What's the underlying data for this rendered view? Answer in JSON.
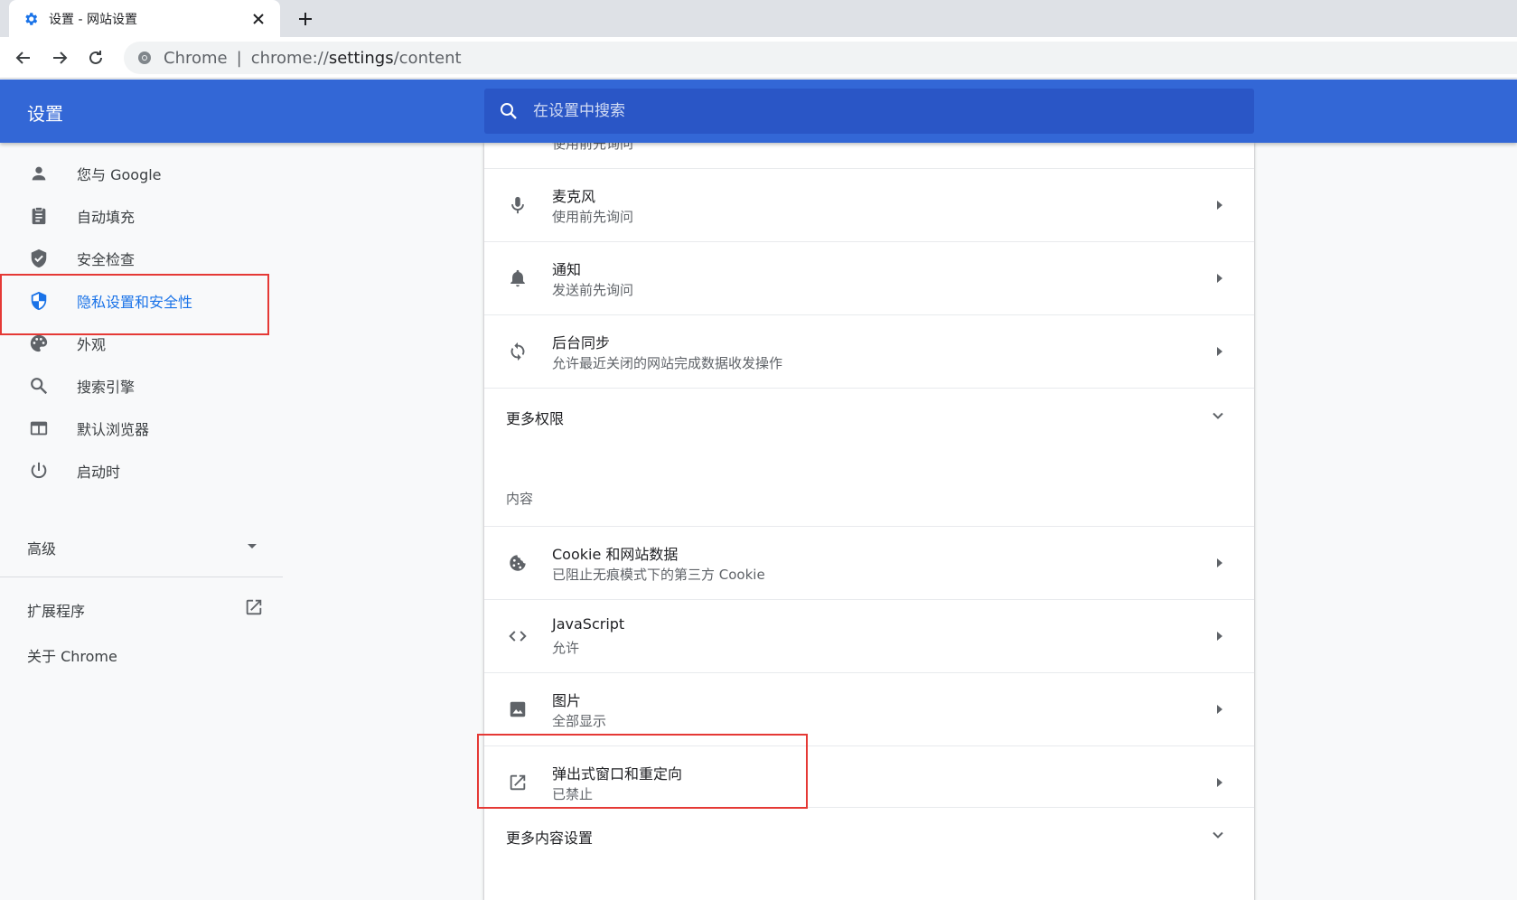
{
  "browser": {
    "tab_title": "设置 - 网站设置",
    "address": {
      "chip": "Chrome",
      "separator": "|",
      "scheme": "chrome://",
      "host": "settings",
      "path": "/content"
    }
  },
  "header": {
    "title": "设置",
    "search_placeholder": "在设置中搜索"
  },
  "sidebar": {
    "items": [
      {
        "label": "您与 Google",
        "icon": "person-icon"
      },
      {
        "label": "自动填充",
        "icon": "clipboard-icon"
      },
      {
        "label": "安全检查",
        "icon": "shield-check-icon"
      },
      {
        "label": "隐私设置和安全性",
        "icon": "shield-privacy-icon",
        "active": true
      },
      {
        "label": "外观",
        "icon": "palette-icon"
      },
      {
        "label": "搜索引擎",
        "icon": "search-icon"
      },
      {
        "label": "默认浏览器",
        "icon": "browser-window-icon"
      },
      {
        "label": "启动时",
        "icon": "power-icon"
      }
    ],
    "advanced": "高级",
    "extensions": "扩展程序",
    "about": "关于 Chrome"
  },
  "content": {
    "cut_off_text": "使用前先询问",
    "permissions": [
      {
        "title": "麦克风",
        "subtitle": "使用前先询问",
        "icon": "microphone-icon"
      },
      {
        "title": "通知",
        "subtitle": "发送前先询问",
        "icon": "bell-icon"
      },
      {
        "title": "后台同步",
        "subtitle": "允许最近关闭的网站完成数据收发操作",
        "icon": "sync-icon"
      }
    ],
    "more_permissions": "更多权限",
    "content_section_label": "内容",
    "content_items": [
      {
        "title": "Cookie 和网站数据",
        "subtitle": "已阻止无痕模式下的第三方 Cookie",
        "icon": "cookie-icon"
      },
      {
        "title": "JavaScript",
        "subtitle": "允许",
        "icon": "code-icon"
      },
      {
        "title": "图片",
        "subtitle": "全部显示",
        "icon": "image-icon"
      },
      {
        "title": "弹出式窗口和重定向",
        "subtitle": "已禁止",
        "icon": "popup-icon"
      }
    ],
    "more_content_settings": "更多内容设置"
  },
  "colors": {
    "header_blue": "#3367d6",
    "search_blue": "#2a56c6",
    "active_blue": "#1a73e8",
    "highlight_red": "#e53935"
  }
}
